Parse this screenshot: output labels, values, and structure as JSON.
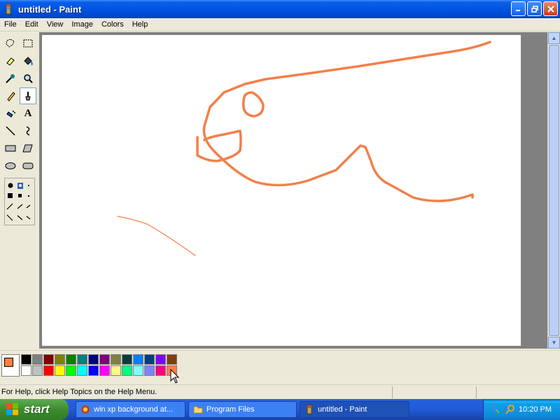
{
  "window": {
    "title": "untitled - Paint",
    "controls": [
      "minimize",
      "maximize",
      "close"
    ]
  },
  "menu": [
    "File",
    "Edit",
    "View",
    "Image",
    "Colors",
    "Help"
  ],
  "tools": [
    {
      "name": "free-form-select-icon"
    },
    {
      "name": "select-icon"
    },
    {
      "name": "eraser-icon"
    },
    {
      "name": "fill-with-color-icon"
    },
    {
      "name": "pick-color-icon"
    },
    {
      "name": "magnifier-icon"
    },
    {
      "name": "pencil-icon"
    },
    {
      "name": "brush-icon",
      "active": true
    },
    {
      "name": "airbrush-icon"
    },
    {
      "name": "text-icon",
      "label": "A"
    },
    {
      "name": "line-icon"
    },
    {
      "name": "curve-icon"
    },
    {
      "name": "rectangle-icon"
    },
    {
      "name": "polygon-icon"
    },
    {
      "name": "ellipse-icon"
    },
    {
      "name": "rounded-rectangle-icon"
    }
  ],
  "colors": {
    "foreground": "#FF8040",
    "background": "#FFFFFF",
    "palette": [
      "#000000",
      "#808080",
      "#800000",
      "#808000",
      "#008000",
      "#008080",
      "#000080",
      "#800080",
      "#808040",
      "#004040",
      "#0080FF",
      "#004080",
      "#8000FF",
      "#804000",
      "#FFFFFF",
      "#C0C0C0",
      "#FF0000",
      "#FFFF00",
      "#00FF00",
      "#00FFFF",
      "#0000FF",
      "#FF00FF",
      "#FFFF80",
      "#00FF80",
      "#80FFFF",
      "#8080FF",
      "#FF0080",
      "#FF8040"
    ]
  },
  "status": {
    "help_text": "For Help, click Help Topics on the Help Menu."
  },
  "taskbar": {
    "start_label": "start",
    "tasks": [
      {
        "label": "win xp background at...",
        "icon": "browser-icon"
      },
      {
        "label": "Program Files",
        "icon": "folder-icon"
      },
      {
        "label": "untitled - Paint",
        "icon": "paint-icon",
        "active": true
      }
    ],
    "clock": "10:20 PM"
  }
}
